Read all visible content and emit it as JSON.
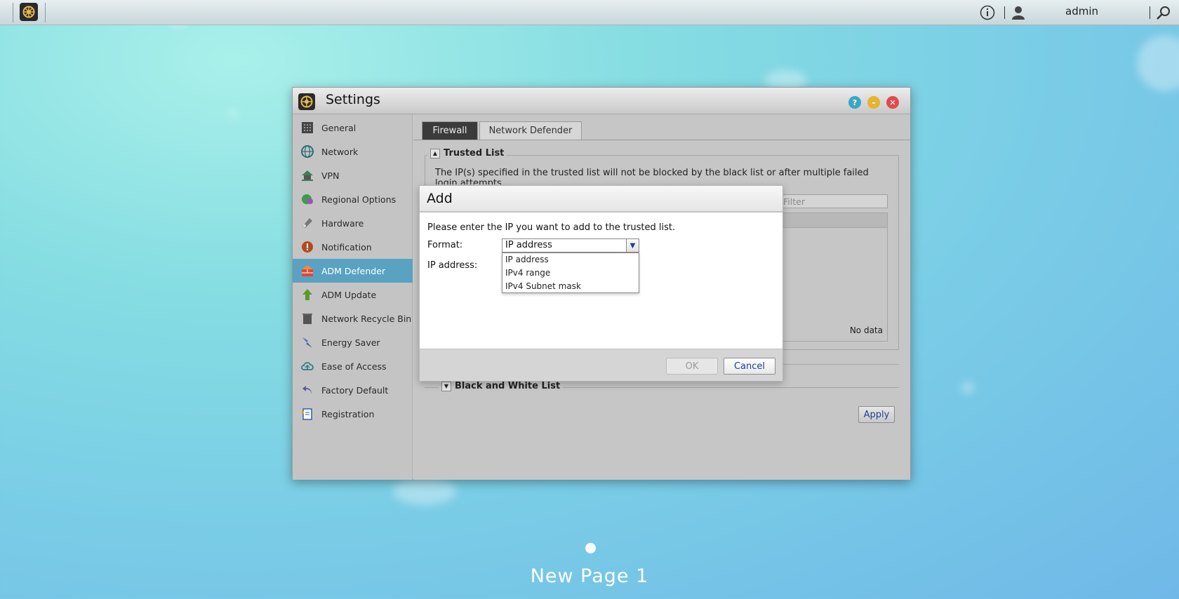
{
  "topbar": {
    "user": "admin"
  },
  "window": {
    "title": "Settings"
  },
  "sidebar": {
    "items": [
      {
        "label": "General",
        "icon": "general-icon"
      },
      {
        "label": "Network",
        "icon": "network-icon"
      },
      {
        "label": "VPN",
        "icon": "vpn-icon"
      },
      {
        "label": "Regional Options",
        "icon": "regional-icon"
      },
      {
        "label": "Hardware",
        "icon": "hardware-icon"
      },
      {
        "label": "Notification",
        "icon": "notification-icon"
      },
      {
        "label": "ADM Defender",
        "icon": "defender-icon",
        "active": true
      },
      {
        "label": "ADM Update",
        "icon": "update-icon"
      },
      {
        "label": "Network Recycle Bin",
        "icon": "recycle-bin-icon"
      },
      {
        "label": "Energy Saver",
        "icon": "energy-icon"
      },
      {
        "label": "Ease of Access",
        "icon": "cloud-icon"
      },
      {
        "label": "Factory Default",
        "icon": "undo-icon"
      },
      {
        "label": "Registration",
        "icon": "registration-icon"
      }
    ]
  },
  "tabs": {
    "firewall": "Firewall",
    "network_defender": "Network Defender"
  },
  "trusted": {
    "legend": "Trusted List",
    "description": "The IP(s) specified in the trusted list will not be blocked by the black list or after multiple failed login attempts.",
    "filter_placeholder": "Filter",
    "no_data": "No data"
  },
  "bwlist": {
    "legend": "Black and White List"
  },
  "apply_label": "Apply",
  "dialog": {
    "title": "Add",
    "message": "Please enter the IP you want to add to the trusted list.",
    "format_label": "Format:",
    "ip_label": "IP address:",
    "selected": "IP address",
    "options": [
      "IP address",
      "IPv4 range",
      "IPv4 Subnet mask"
    ],
    "ok": "OK",
    "cancel": "Cancel"
  },
  "page_label": "New Page 1",
  "colors": {
    "active_sidebar": "#5aa2c2",
    "link_blue": "#1f3f8f",
    "help": "#3aa6c4",
    "minimize": "#e5b530",
    "close": "#e14b4b"
  }
}
